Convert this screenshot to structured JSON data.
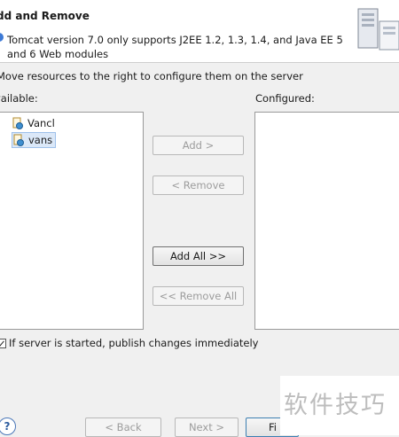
{
  "header": {
    "title": "dd and Remove",
    "message": "Tomcat version 7.0 only supports J2EE 1.2, 1.3, 1.4, and Java EE 5\nand 6 Web modules"
  },
  "instruction": "Move resources to the right to configure them on the server",
  "available": {
    "label": "vailable:",
    "items": [
      "Vancl",
      "vans"
    ],
    "selected": "vans"
  },
  "configured": {
    "label": "Configured:",
    "items": []
  },
  "buttons": {
    "add": "Add >",
    "remove": "< Remove",
    "add_all": "Add All >>",
    "remove_all": "<< Remove All"
  },
  "publish": {
    "label": "If server is started, publish changes immediately",
    "checked": true
  },
  "footer": {
    "help": "?",
    "back": "< Back",
    "next": "Next >",
    "finish": "Fi"
  },
  "watermark": "软件技巧",
  "colors": {
    "info": "#3d7ad6",
    "selection": "#dbe8f8",
    "finish_border": "#3c7fb1"
  },
  "icons": {
    "info": "info-icon",
    "project": "web-project-icon",
    "banner": "server-wizard-icon",
    "help": "help-icon"
  }
}
